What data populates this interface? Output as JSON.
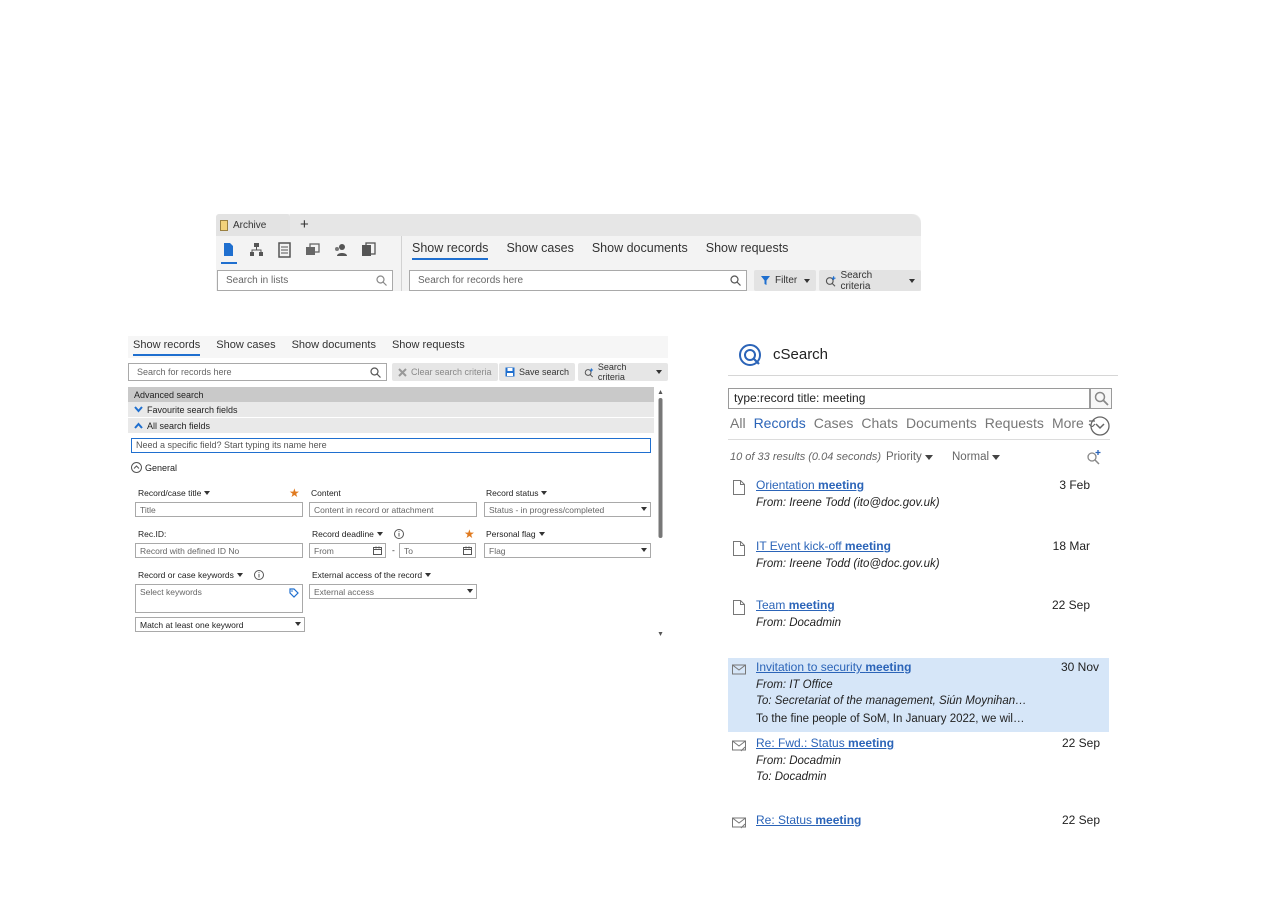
{
  "archive_toolbar": {
    "tab_label": "Archive",
    "new_tab_symbol": "+",
    "list_icons": [
      "document-icon",
      "org-chart-icon",
      "list-icon",
      "cases-icon",
      "contacts-icon",
      "files-icon"
    ],
    "list_search_placeholder": "Search in lists",
    "nav_tabs": [
      "Show records",
      "Show cases",
      "Show documents",
      "Show requests"
    ],
    "active_tab": "Show records",
    "record_search_placeholder": "Search for records here",
    "filter_label": "Filter",
    "search_criteria_label": "Search criteria"
  },
  "advanced_search": {
    "nav_tabs": [
      "Show records",
      "Show cases",
      "Show documents",
      "Show requests"
    ],
    "record_search_placeholder": "Search for records here",
    "clear_label": "Clear search criteria",
    "save_label": "Save search",
    "criteria_label": "Search criteria",
    "advanced_header": "Advanced search",
    "favourite_fields": "Favourite search fields",
    "all_fields": "All search fields",
    "field_finder_placeholder": "Need a specific field? Start typing its name here",
    "general_section": "General",
    "fields": {
      "record_case_title": {
        "label": "Record/case title",
        "placeholder": "Title"
      },
      "content": {
        "label": "Content",
        "placeholder": "Content in record or attachment"
      },
      "record_status": {
        "label": "Record status",
        "value": "Status - in progress/completed"
      },
      "rec_id": {
        "label": "Rec.ID:",
        "placeholder": "Record with defined ID No"
      },
      "record_deadline": {
        "label": "Record deadline",
        "from": "From",
        "separator": "-",
        "to": "To"
      },
      "personal_flag": {
        "label": "Personal flag",
        "value": "Flag"
      },
      "keywords": {
        "label": "Record or case keywords",
        "placeholder": "Select keywords",
        "match_value": "Match at least one keyword"
      },
      "external_access": {
        "label": "External access of the record",
        "value": "External access"
      }
    }
  },
  "csearch": {
    "title": "cSearch",
    "query": "type:record title: meeting",
    "categories": [
      "All",
      "Records",
      "Cases",
      "Chats",
      "Documents",
      "Requests",
      "More"
    ],
    "active_category": "Records",
    "result_meta": "10 of 33 results (0.04 seconds)",
    "sort_priority": "Priority",
    "sort_normal": "Normal",
    "accent_color": "#2b64b8",
    "highlight_color": "#d6e6f8",
    "results": [
      {
        "icon": "document-icon",
        "title_pre": "Orientation ",
        "title_bold": "meeting",
        "date": "3 Feb",
        "lines": [
          "From: Ireene Todd (ito@doc.gov.uk)"
        ],
        "highlighted": false
      },
      {
        "icon": "document-icon",
        "title_pre": "IT Event kick-off ",
        "title_bold": "meeting",
        "date": "18 Mar",
        "lines": [
          "From: Ireene Todd (ito@doc.gov.uk)"
        ],
        "highlighted": false
      },
      {
        "icon": "document-icon",
        "title_pre": "Team ",
        "title_bold": "meeting",
        "date": "22 Sep",
        "lines": [
          "From: Docadmin"
        ],
        "highlighted": false
      },
      {
        "icon": "mail-icon",
        "title_pre": "Invitation to security ",
        "title_bold": "meeting",
        "date": "30 Nov",
        "lines": [
          "From: IT Office",
          "To: Secretariat of the management, Siún Moynihan…"
        ],
        "snippet": "To the fine people of SoM, In January 2022, we wil…",
        "highlighted": true
      },
      {
        "icon": "mail-reply-icon",
        "title_pre": "Re: Fwd.: Status ",
        "title_bold": "meeting",
        "date": "22 Sep",
        "lines": [
          "From: Docadmin",
          "To: Docadmin"
        ],
        "highlighted": false
      },
      {
        "icon": "mail-reply-icon",
        "title_pre": "Re: Status ",
        "title_bold": "meeting",
        "date": "22 Sep",
        "lines": [],
        "highlighted": false
      }
    ]
  }
}
